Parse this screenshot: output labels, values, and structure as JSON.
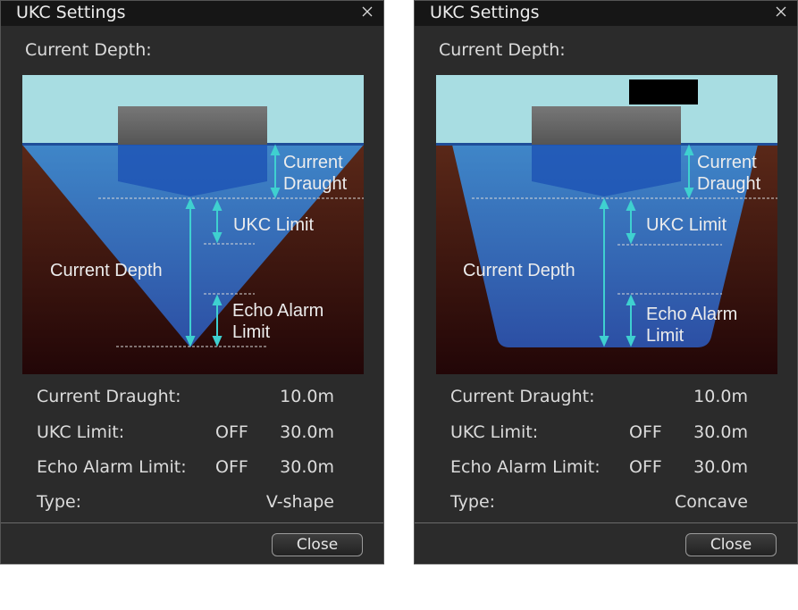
{
  "dialogs": [
    {
      "title": "UKC Settings",
      "current_depth_label": "Current Depth:",
      "current_depth_value": "",
      "diagram": {
        "shape": "V-shape",
        "labels": {
          "current_draught_1": "Current",
          "current_draught_2": "Draught",
          "ukc_limit": "UKC Limit",
          "current_depth": "Current Depth",
          "echo_alarm_1": "Echo Alarm",
          "echo_alarm_2": "Limit"
        }
      },
      "rows": [
        {
          "label": "Current Draught:",
          "state": "",
          "value": "10.0m"
        },
        {
          "label": "UKC Limit:",
          "state": "OFF",
          "value": "30.0m"
        },
        {
          "label": "Echo Alarm Limit:",
          "state": "OFF",
          "value": "30.0m"
        },
        {
          "label": "Type:",
          "state": "",
          "value": "V-shape"
        }
      ],
      "close_button": "Close"
    },
    {
      "title": "UKC Settings",
      "current_depth_label": "Current Depth:",
      "current_depth_value": "",
      "diagram": {
        "shape": "Concave",
        "labels": {
          "current_draught_1": "Current",
          "current_draught_2": "Draught",
          "ukc_limit": "UKC Limit",
          "current_depth": "Current Depth",
          "echo_alarm_1": "Echo Alarm",
          "echo_alarm_2": "Limit"
        }
      },
      "rows": [
        {
          "label": "Current Draught:",
          "state": "",
          "value": "10.0m"
        },
        {
          "label": "UKC Limit:",
          "state": "OFF",
          "value": "30.0m"
        },
        {
          "label": "Echo Alarm Limit:",
          "state": "OFF",
          "value": "30.0m"
        },
        {
          "label": "Type:",
          "state": "",
          "value": "Concave"
        }
      ],
      "close_button": "Close"
    }
  ],
  "colors": {
    "sky": "#a8dde2",
    "seabed_top": "#5a2818",
    "seabed_bottom": "#220607",
    "water_top": "#3f86c8",
    "water_bottom": "#2c4fa4",
    "arrow": "#3fd0d0"
  }
}
